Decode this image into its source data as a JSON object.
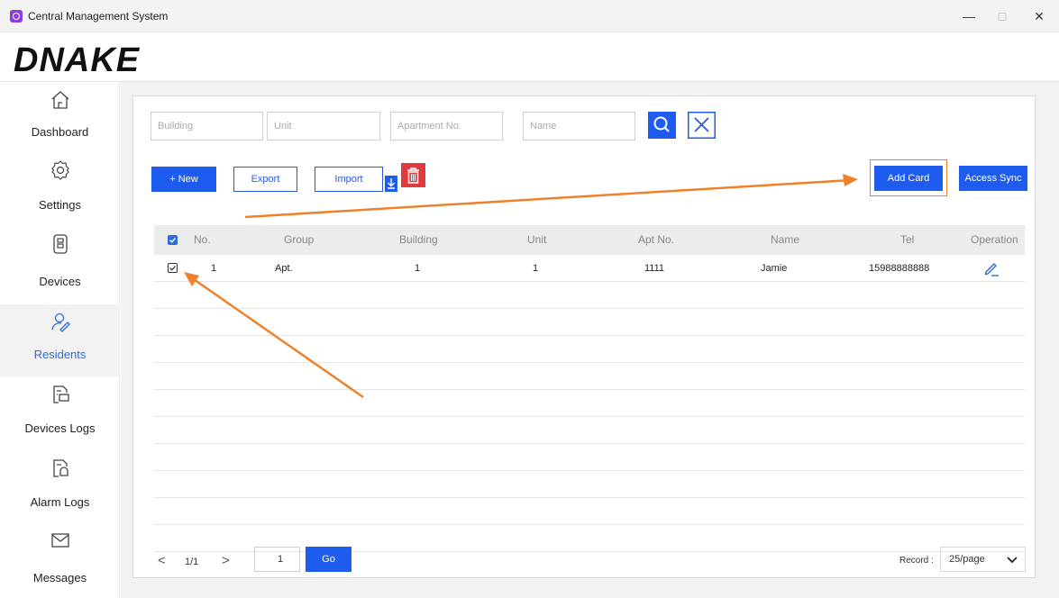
{
  "window": {
    "title": "Central Management System",
    "controls": {
      "minimize": "—",
      "maximize": "□",
      "close": "✕"
    }
  },
  "brand": {
    "logo": "DNAKE"
  },
  "sidebar": {
    "items": [
      {
        "label": "Dashboard",
        "icon": "home-icon",
        "active": false
      },
      {
        "label": "Settings",
        "icon": "gear-icon",
        "active": false
      },
      {
        "label": "Devices",
        "icon": "device-icon",
        "active": false
      },
      {
        "label": "Residents",
        "icon": "residents-icon",
        "active": true
      },
      {
        "label": "Devices Logs",
        "icon": "devices-logs-icon",
        "active": false
      },
      {
        "label": "Alarm Logs",
        "icon": "alarm-logs-icon",
        "active": false
      },
      {
        "label": "Messages",
        "icon": "envelope-icon",
        "active": false
      }
    ]
  },
  "filters": {
    "building_placeholder": "Building",
    "unit_placeholder": "Unit",
    "apartment_placeholder": "Apartment No.",
    "name_placeholder": "Name"
  },
  "toolbar": {
    "new_label": "+ New",
    "export_label": "Export",
    "import_label": "Import",
    "add_card_label": "Add Card",
    "access_sync_label": "Access Sync"
  },
  "table": {
    "headers": [
      "No.",
      "Group",
      "Building",
      "Unit",
      "Apt No.",
      "Name",
      "Tel",
      "Operation"
    ],
    "rows": [
      {
        "no": "1",
        "group": "Apt.",
        "building": "1",
        "unit": "1",
        "apt": "1111",
        "name": "Jamie",
        "tel": "15988888888",
        "checked": true
      }
    ]
  },
  "pager": {
    "prev": "<",
    "page_info": "1/1",
    "next": ">",
    "page_input": "1",
    "go_label": "Go",
    "record_label": "Record :",
    "page_size": "25/page"
  },
  "colors": {
    "accent": "#1e5cf0",
    "delete": "#e0393e",
    "annotation": "#f0812b",
    "active_nav_text": "#2d6bd6"
  }
}
